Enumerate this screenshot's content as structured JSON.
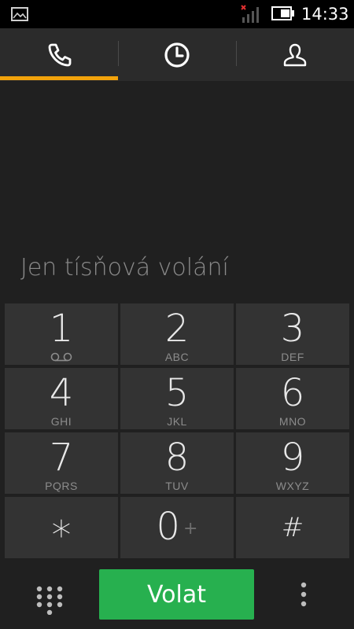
{
  "status_bar": {
    "time": "14:33",
    "icons": [
      "image-notification-icon",
      "no-signal-icon",
      "battery-icon"
    ]
  },
  "tabs": [
    {
      "name": "dialer",
      "icon": "phone-icon",
      "selected": true
    },
    {
      "name": "call-log",
      "icon": "clock-icon",
      "selected": false
    },
    {
      "name": "contacts",
      "icon": "person-icon",
      "selected": false
    }
  ],
  "display": {
    "hint": "Jen tísňová volání"
  },
  "keypad": {
    "keys": [
      {
        "digit": "1",
        "letters": ""
      },
      {
        "digit": "2",
        "letters": "ABC"
      },
      {
        "digit": "3",
        "letters": "DEF"
      },
      {
        "digit": "4",
        "letters": "GHI"
      },
      {
        "digit": "5",
        "letters": "JKL"
      },
      {
        "digit": "6",
        "letters": "MNO"
      },
      {
        "digit": "7",
        "letters": "PQRS"
      },
      {
        "digit": "8",
        "letters": "TUV"
      },
      {
        "digit": "9",
        "letters": "WXYZ"
      },
      {
        "digit": "*",
        "letters": ""
      },
      {
        "digit": "0",
        "letters": "+"
      },
      {
        "digit": "#",
        "letters": ""
      }
    ]
  },
  "bottom_bar": {
    "call_label": "Volat"
  },
  "colors": {
    "accent": "#f2a30b",
    "call_green": "#27b04f",
    "key_bg": "#333333",
    "background": "#202020"
  }
}
